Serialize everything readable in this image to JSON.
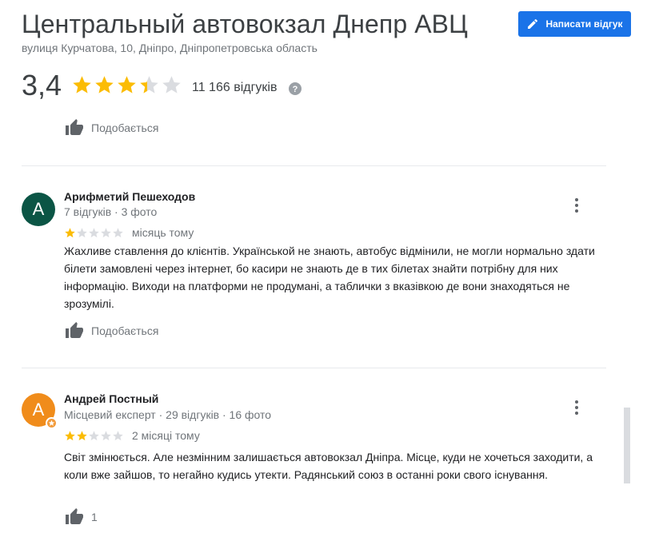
{
  "header": {
    "title": "Центральный автовокзал Днепр АВЦ",
    "address": "вулиця Курчатова, 10, Дніпро, Дніпропетровська область",
    "write_review_label": "Написати відгук",
    "rating": "3,4",
    "rating_value": 3.4,
    "reviews_count": "11 166 відгуків"
  },
  "top_like_label": "Подобається",
  "reviews": [
    {
      "avatar_letter": "А",
      "avatar_color": "#0b5545",
      "author": "Арифметий Пешеходов",
      "meta": "7 відгуків · 3 фото",
      "stars": 1,
      "when": "місяць тому",
      "text": "Жахливе ставлення до клієнтів. Українськой не знають, автобус відмінили, не могли нормально здати білети замовлені через інтернет, бо касири не знають де в тих білетах знайти потрібну для них інформацію. Виходи на платформи не продумані, а таблички з вказівкою де вони знаходяться не зрозумілі.",
      "like_label": "Подобається"
    },
    {
      "avatar_letter": "А",
      "avatar_color": "#f08c1b",
      "author": "Андрей Постный",
      "meta": "Місцевий експерт · 29 відгуків · 16 фото",
      "stars": 2,
      "when": "2 місяці тому",
      "text": "Світ змінюється. Але незмінним залишається  автовокзал Дніпра. Місце, куди не хочеться заходити, а коли вже зайшов, то негайно кудись утекти. Радянський союз в останні роки свого існування.",
      "like_label": "1"
    }
  ],
  "colors": {
    "star_filled": "#fbbc04",
    "star_empty": "#dadce0",
    "button": "#1a73e8"
  }
}
